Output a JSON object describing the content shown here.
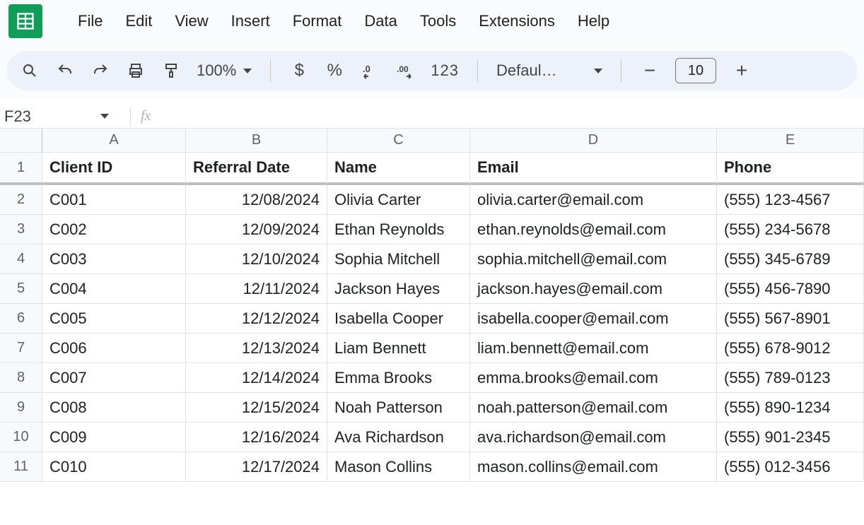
{
  "menu": {
    "items": [
      "File",
      "Edit",
      "View",
      "Insert",
      "Format",
      "Data",
      "Tools",
      "Extensions",
      "Help"
    ]
  },
  "toolbar": {
    "zoom": "100%",
    "currency": "$",
    "percent": "%",
    "number_format": "123",
    "font": "Defaul…",
    "font_size": "10"
  },
  "namebox": {
    "ref": "F23",
    "fx": "fx"
  },
  "sheet": {
    "columns": [
      "A",
      "B",
      "C",
      "D",
      "E"
    ],
    "headers": [
      "Client ID",
      "Referral Date",
      "Name",
      "Email",
      "Phone"
    ],
    "rows": [
      {
        "n": "2",
        "id": "C001",
        "date": "12/08/2024",
        "name": "Olivia Carter",
        "email": "olivia.carter@email.com",
        "phone": "(555) 123-4567"
      },
      {
        "n": "3",
        "id": "C002",
        "date": "12/09/2024",
        "name": "Ethan Reynolds",
        "email": "ethan.reynolds@email.com",
        "phone": "(555) 234-5678"
      },
      {
        "n": "4",
        "id": "C003",
        "date": "12/10/2024",
        "name": "Sophia Mitchell",
        "email": "sophia.mitchell@email.com",
        "phone": "(555) 345-6789"
      },
      {
        "n": "5",
        "id": "C004",
        "date": "12/11/2024",
        "name": "Jackson Hayes",
        "email": "jackson.hayes@email.com",
        "phone": "(555) 456-7890"
      },
      {
        "n": "6",
        "id": "C005",
        "date": "12/12/2024",
        "name": "Isabella Cooper",
        "email": "isabella.cooper@email.com",
        "phone": "(555) 567-8901"
      },
      {
        "n": "7",
        "id": "C006",
        "date": "12/13/2024",
        "name": "Liam Bennett",
        "email": "liam.bennett@email.com",
        "phone": "(555) 678-9012"
      },
      {
        "n": "8",
        "id": "C007",
        "date": "12/14/2024",
        "name": "Emma Brooks",
        "email": "emma.brooks@email.com",
        "phone": "(555) 789-0123"
      },
      {
        "n": "9",
        "id": "C008",
        "date": "12/15/2024",
        "name": "Noah Patterson",
        "email": "noah.patterson@email.com",
        "phone": "(555) 890-1234"
      },
      {
        "n": "10",
        "id": "C009",
        "date": "12/16/2024",
        "name": "Ava Richardson",
        "email": "ava.richardson@email.com",
        "phone": "(555) 901-2345"
      },
      {
        "n": "11",
        "id": "C010",
        "date": "12/17/2024",
        "name": "Mason Collins",
        "email": "mason.collins@email.com",
        "phone": "(555) 012-3456"
      }
    ],
    "header_row_num": "1"
  }
}
